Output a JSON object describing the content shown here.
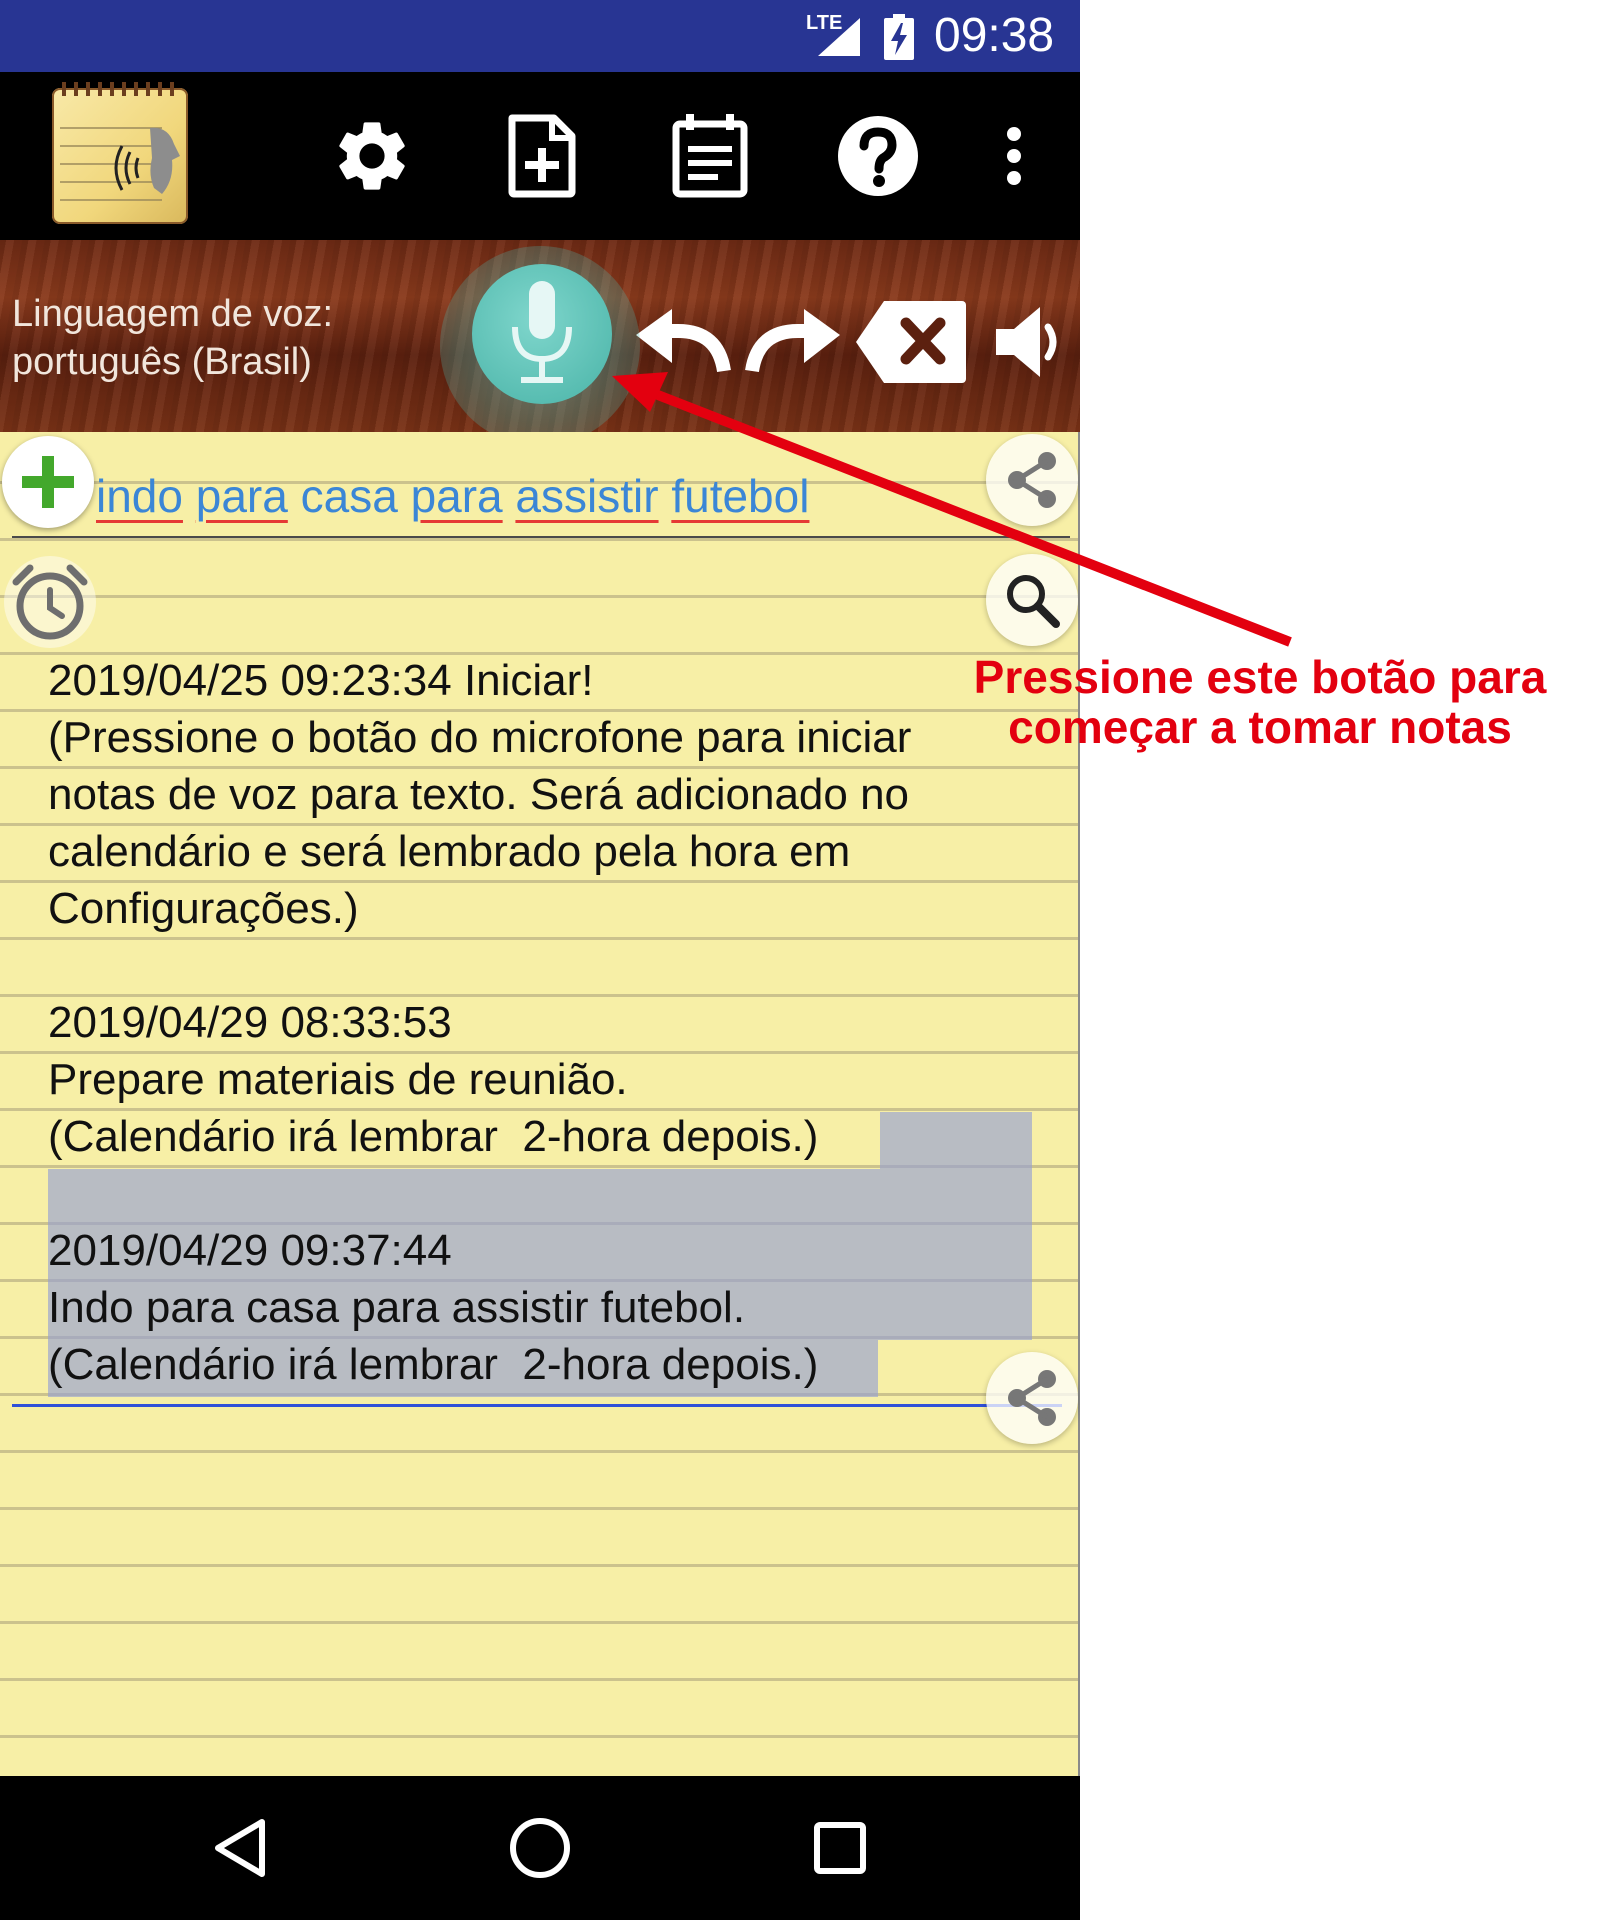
{
  "status_bar": {
    "network": "LTE",
    "time": "09:38"
  },
  "toolbar": {
    "icons": [
      "app-logo",
      "gear-icon",
      "new-document-icon",
      "notes-list-icon",
      "help-icon",
      "more-vert-icon"
    ]
  },
  "voice_bar": {
    "language_label": "Linguagem de voz:",
    "language_value": "português (Brasil)",
    "icons": [
      "mic-icon",
      "undo-icon",
      "redo-icon",
      "backspace-icon",
      "speaker-icon"
    ]
  },
  "note": {
    "title_words": [
      "indo",
      "para",
      "casa",
      "para",
      "assistir",
      "futebol"
    ],
    "entries": [
      {
        "timestamp": "2019/04/25 09:23:34 Iniciar!",
        "lines": [
          "(Pressione o botão do microfone para iniciar",
          "notas de voz para texto. Será adicionado no",
          "calendário e será lembrado pela hora em",
          "Configurações.)"
        ]
      },
      {
        "timestamp": "2019/04/29 08:33:53",
        "lines": [
          "Prepare materiais de reunião.",
          "(Calendário irá lembrar  2-hora depois.)"
        ]
      },
      {
        "timestamp": "2019/04/29 09:37:44",
        "lines": [
          "Indo para casa para assistir futebol.",
          "(Calendário irá lembrar  2-hora depois.)"
        ]
      }
    ]
  },
  "annotation": {
    "line1": "Pressione este botão para",
    "line2": "começar a tomar notas",
    "color": "#e3000f"
  },
  "colors": {
    "status_bar": "#283593",
    "paper": "#f7efa6",
    "title_text": "#3b86d6",
    "mic_button": "#4db6ac",
    "selection": "#9aa0d2"
  }
}
